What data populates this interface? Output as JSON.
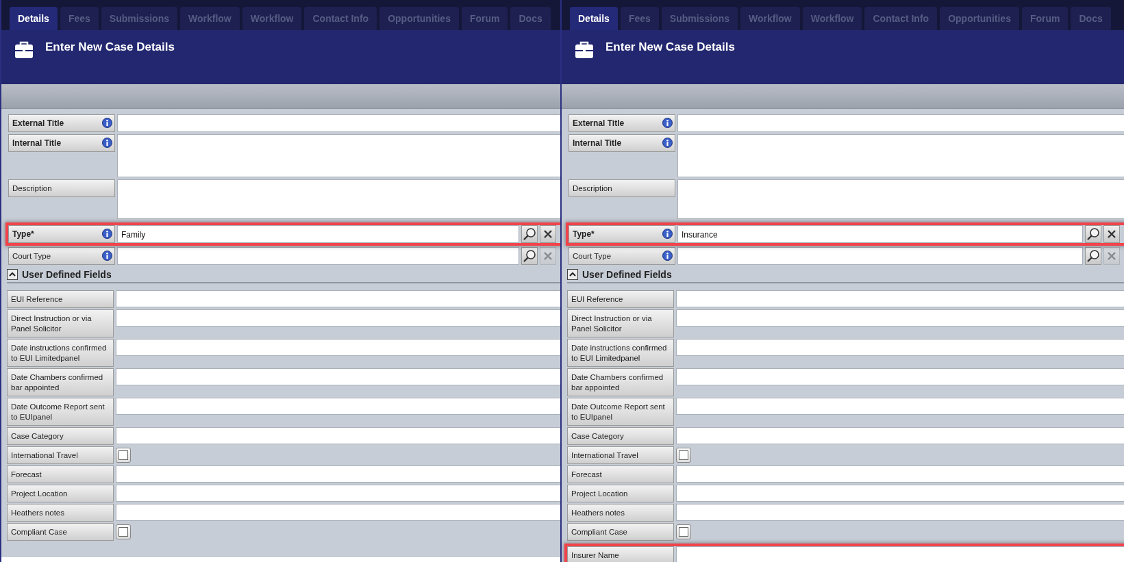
{
  "panels": [
    {
      "tabs": [
        {
          "label": "Details",
          "selected": true
        },
        {
          "label": "Fees",
          "selected": false
        },
        {
          "label": "Submissions",
          "selected": false
        },
        {
          "label": "Workflow",
          "selected": false
        },
        {
          "label": "Workflow",
          "selected": false
        },
        {
          "label": "Contact Info",
          "selected": false
        },
        {
          "label": "Opportunities",
          "selected": false
        },
        {
          "label": "Forum",
          "selected": false
        },
        {
          "label": "Docs",
          "selected": false
        }
      ],
      "title": "Enter New Case Details",
      "fields": [
        {
          "kind": "text",
          "label": "External Title",
          "bold": true,
          "info": true,
          "highlighted": false
        },
        {
          "kind": "textarea",
          "label": "Internal Title",
          "bold": true,
          "info": true,
          "highlighted": false
        },
        {
          "kind": "textarea",
          "label": "Description",
          "bold": false,
          "info": false,
          "highlighted": false
        },
        {
          "kind": "lookup",
          "label": "Type*",
          "bold": true,
          "info": true,
          "value": "Family",
          "clear_enabled": true,
          "highlighted": true
        },
        {
          "kind": "lookup",
          "label": "Court Type",
          "bold": false,
          "info": true,
          "clear_enabled": false,
          "highlighted": false
        }
      ],
      "section": {
        "title": "User Defined Fields",
        "expanded": true,
        "fields": [
          {
            "kind": "text",
            "label": "EUI Reference",
            "highlighted": false
          },
          {
            "kind": "text",
            "label": "Direct Instruction or via Panel Solicitor",
            "highlighted": false
          },
          {
            "kind": "text",
            "label": "Date instructions confirmed to EUI Limitedpanel",
            "highlighted": false
          },
          {
            "kind": "text",
            "label": "Date Chambers confirmed bar appointed",
            "highlighted": false
          },
          {
            "kind": "text",
            "label": "Date Outcome Report sent to EUIpanel",
            "highlighted": false
          },
          {
            "kind": "text",
            "label": "Case Category",
            "highlighted": false
          },
          {
            "kind": "checkbox",
            "label": "International Travel",
            "checked": false,
            "highlighted": false
          },
          {
            "kind": "text",
            "label": "Forecast",
            "highlighted": false
          },
          {
            "kind": "text",
            "label": "Project Location",
            "highlighted": false
          },
          {
            "kind": "text",
            "label": "Heathers notes",
            "highlighted": false
          },
          {
            "kind": "checkbox",
            "label": "Compliant Case",
            "checked": false,
            "highlighted": false
          }
        ]
      }
    },
    {
      "tabs": [
        {
          "label": "Details",
          "selected": true
        },
        {
          "label": "Fees",
          "selected": false
        },
        {
          "label": "Submissions",
          "selected": false
        },
        {
          "label": "Workflow",
          "selected": false
        },
        {
          "label": "Workflow",
          "selected": false
        },
        {
          "label": "Contact Info",
          "selected": false
        },
        {
          "label": "Opportunities",
          "selected": false
        },
        {
          "label": "Forum",
          "selected": false
        },
        {
          "label": "Docs",
          "selected": false
        }
      ],
      "title": "Enter New Case Details",
      "fields": [
        {
          "kind": "text",
          "label": "External Title",
          "bold": true,
          "info": true,
          "highlighted": false
        },
        {
          "kind": "textarea",
          "label": "Internal Title",
          "bold": true,
          "info": true,
          "highlighted": false
        },
        {
          "kind": "textarea",
          "label": "Description",
          "bold": false,
          "info": false,
          "highlighted": false
        },
        {
          "kind": "lookup",
          "label": "Type*",
          "bold": true,
          "info": true,
          "value": "Insurance",
          "clear_enabled": true,
          "highlighted": true
        },
        {
          "kind": "lookup",
          "label": "Court Type",
          "bold": false,
          "info": true,
          "clear_enabled": false,
          "highlighted": false
        }
      ],
      "section": {
        "title": "User Defined Fields",
        "expanded": true,
        "fields": [
          {
            "kind": "text",
            "label": "EUI Reference",
            "highlighted": false
          },
          {
            "kind": "text",
            "label": "Direct Instruction or via Panel Solicitor",
            "highlighted": false
          },
          {
            "kind": "text",
            "label": "Date instructions confirmed to EUI Limitedpanel",
            "highlighted": false
          },
          {
            "kind": "text",
            "label": "Date Chambers confirmed bar appointed",
            "highlighted": false
          },
          {
            "kind": "text",
            "label": "Date Outcome Report sent to EUIpanel",
            "highlighted": false
          },
          {
            "kind": "text",
            "label": "Case Category",
            "highlighted": false
          },
          {
            "kind": "checkbox",
            "label": "International Travel",
            "checked": false,
            "highlighted": false
          },
          {
            "kind": "text",
            "label": "Forecast",
            "highlighted": false
          },
          {
            "kind": "text",
            "label": "Project Location",
            "highlighted": false
          },
          {
            "kind": "text",
            "label": "Heathers notes",
            "highlighted": false
          },
          {
            "kind": "checkbox",
            "label": "Compliant Case",
            "checked": false,
            "highlighted": false
          },
          {
            "kind": "text",
            "label": "Insurer Name",
            "highlighted": true
          }
        ]
      }
    }
  ]
}
